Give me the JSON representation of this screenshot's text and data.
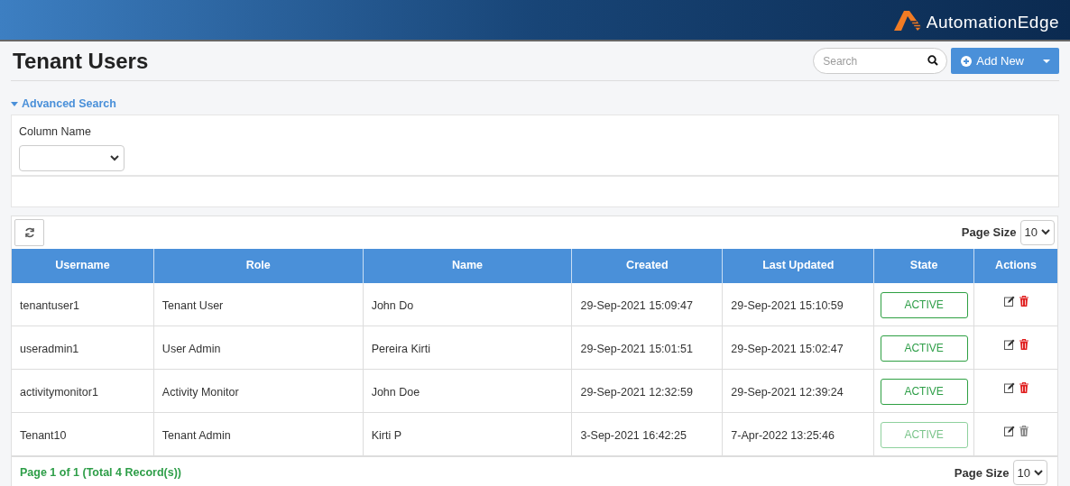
{
  "header": {
    "logo_text": "AutomationEdge"
  },
  "page_title": "Tenant Users",
  "search": {
    "placeholder": "Search"
  },
  "add_button": "Add New",
  "advanced_search": {
    "label": "Advanced Search",
    "expanded": true,
    "field_label": "Column Name"
  },
  "toolbar": {
    "page_size_label": "Page Size",
    "page_size_value": "10"
  },
  "table": {
    "columns": [
      "Username",
      "Role",
      "Name",
      "Created",
      "Last Updated",
      "State",
      "Actions"
    ],
    "rows": [
      {
        "cells": [
          "tenantuser1",
          "Tenant User",
          "John Do",
          "29-Sep-2021 15:09:47",
          "29-Sep-2021 15:10:59"
        ],
        "state": "ACTIVE",
        "disabled": false
      },
      {
        "cells": [
          "useradmin1",
          "User Admin",
          "Pereira Kirti",
          "29-Sep-2021 15:01:51",
          "29-Sep-2021 15:02:47"
        ],
        "state": "ACTIVE",
        "disabled": false
      },
      {
        "cells": [
          "activitymonitor1",
          "Activity Monitor",
          "John Doe",
          "29-Sep-2021 12:32:59",
          "29-Sep-2021 12:39:24"
        ],
        "state": "ACTIVE",
        "disabled": false
      },
      {
        "cells": [
          "Tenant10",
          "Tenant Admin",
          "Kirti P",
          "3-Sep-2021 16:42:25",
          "7-Apr-2022 13:25:46"
        ],
        "state": "ACTIVE",
        "disabled": true
      }
    ]
  },
  "footer": {
    "pagination": "Page 1 of 1 (Total 4 Record(s))",
    "page_size_label": "Page Size",
    "page_size_value": "10"
  }
}
